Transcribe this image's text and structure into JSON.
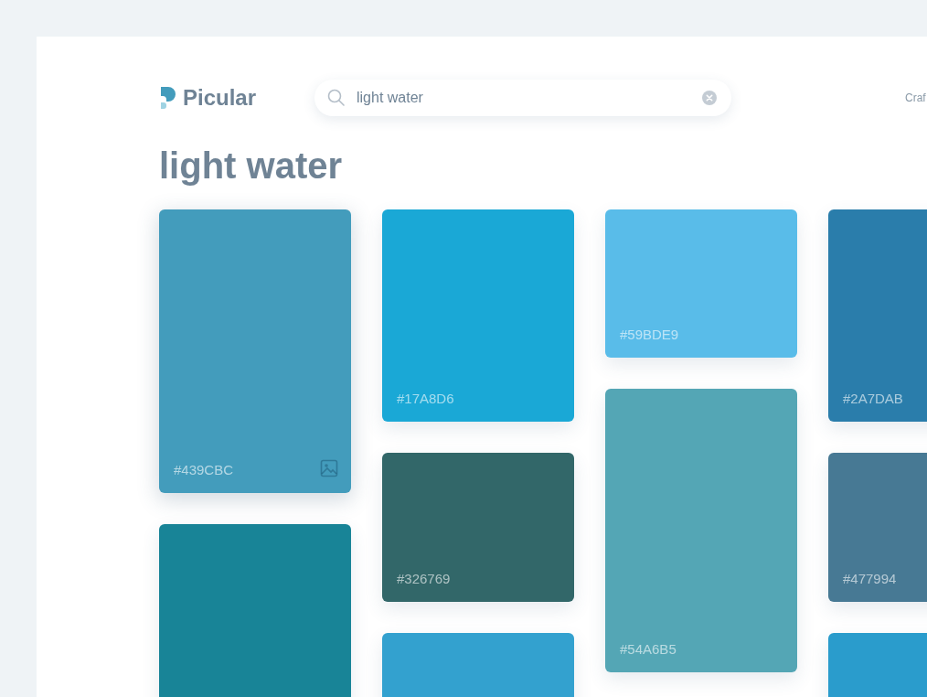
{
  "brand": {
    "name": "Picular"
  },
  "search": {
    "value": "light water"
  },
  "nav": {
    "link": "Craf"
  },
  "heading": "light water",
  "columns": [
    {
      "swatches": [
        {
          "hex": "#439CBC",
          "color": "#439cbc",
          "hover": true
        },
        {
          "color": "#188497",
          "hover": false
        }
      ]
    },
    {
      "swatches": [
        {
          "hex": "#17A8D6",
          "color": "#1aa8d6",
          "hover": false
        },
        {
          "hex": "#326769",
          "color": "#326769",
          "hover": false
        },
        {
          "color": "#33a1cf",
          "hover": false
        }
      ]
    },
    {
      "swatches": [
        {
          "hex": "#59BDE9",
          "color": "#59bce9",
          "hover": false
        },
        {
          "hex": "#54A6B5",
          "color": "#54a6b5",
          "hover": false
        }
      ]
    },
    {
      "swatches": [
        {
          "hex": "#2A7DAB",
          "color": "#2a7dab",
          "hover": false
        },
        {
          "hex": "#477994",
          "color": "#477994",
          "hover": false
        },
        {
          "color": "#2a9ccc",
          "hover": false
        }
      ]
    }
  ]
}
